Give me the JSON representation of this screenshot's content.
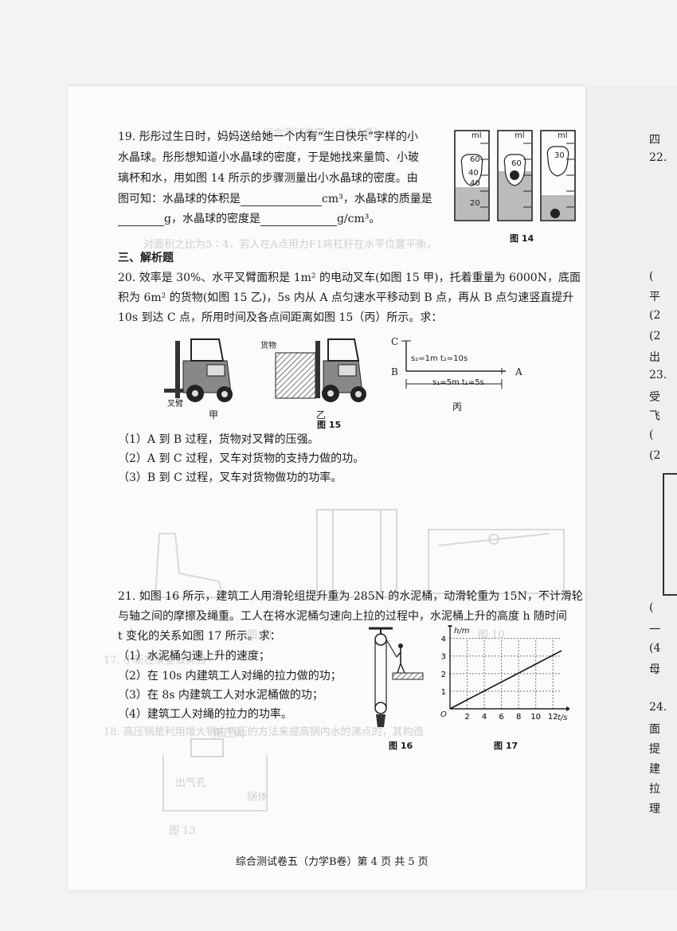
{
  "q19": {
    "line1": "19.  彤彤过生日时，妈妈送给她一个内有“生日快乐”字样的小",
    "line2": "水晶球。彤彤想知道小水晶球的密度，于是她找来量筒、小玻",
    "line3": "璃杯和水，用如图 14 所示的步骤测量出小水晶球的密度。由",
    "line4a": "图可知：水晶球的体积是",
    "line4b": "cm³，水晶球的质量是",
    "line5a": "g，水晶球的密度是",
    "line5b": "g/cm³。",
    "figure_caption": "图 14",
    "cylinder_unit": "ml",
    "cylinder_ticks": [
      "60",
      "40",
      "20"
    ],
    "cylinder_readings": [
      "40",
      "60",
      "30"
    ]
  },
  "section3": "三、解析题",
  "q20": {
    "line1": "20.  效率是 30%、水平叉臂面积是 1m² 的电动叉车(如图 15 甲)，托着重量为 6000N，底面",
    "line2": "积为 6m² 的货物(如图 15 乙)，5s 内从 A 点匀速水平移动到 B 点，再从 B 点匀速竖直提升",
    "line3": "10s 到达 C 点，所用时间及各点间距离如图 15（丙）所示。求：",
    "label_fork": "叉臂",
    "label_cargo": "货物",
    "sub_jia": "甲",
    "sub_yi": "乙",
    "sub_bing": "丙",
    "point_a": "A",
    "point_b": "B",
    "point_c": "C",
    "s2_text": "s₂=1m t₂=10s",
    "s1_text": "s₁=5m t₁=5s",
    "figure_caption": "图 15",
    "sub1": "（1）A 到 B 过程，货物对叉臂的压强。",
    "sub2": "（2）A 到 C 过程，叉车对货物的支持力做的功。",
    "sub3": "（3）B 到 C 过程，叉车对货物做功的功率。"
  },
  "q21": {
    "line1": "21.  如图 16 所示，建筑工人用滑轮组提升重为 285N 的水泥桶，动滑轮重为 15N，不计滑轮",
    "line2": "与轴之间的摩擦及绳重。工人在将水泥桶匀速向上拉的过程中，水泥桶上升的高度 h 随时间",
    "line3": "t 变化的关系如图 17 所示。求：",
    "sub1": "（1）水泥桶匀速上升的速度；",
    "sub2": "（2）在 10s 内建筑工人对绳的拉力做的功；",
    "sub3": "（3）在 8s 内建筑工人对水泥桶做的功；",
    "sub4": "（4）建筑工人对绳的拉力的功率。",
    "fig16_caption": "图 16",
    "fig17_caption": "图 17",
    "graph_ylabel": "h/m",
    "graph_xlabel": "t/s",
    "graph_origin": "O"
  },
  "chart_data": {
    "type": "line",
    "xlabel": "t/s",
    "ylabel": "h/m",
    "x_ticks": [
      "2",
      "4",
      "6",
      "8",
      "10",
      "12"
    ],
    "y_ticks": [
      "1",
      "2",
      "3",
      "4"
    ],
    "xlim": [
      0,
      13
    ],
    "ylim": [
      0,
      4.3
    ],
    "series": [
      {
        "x": [
          0,
          13
        ],
        "y": [
          0,
          3.3
        ]
      }
    ],
    "grid": true
  },
  "ghost_text": {
    "g1": "对面积之比为5∶4，若人在A点用力F1将杠杆在水平位置平衡，",
    "g2": "综合测试卷四（力学A卷）",
    "g3": "图 11",
    "g4": "图 10",
    "g5": "图 13",
    "g6": "限压阀",
    "g7": "出气孔",
    "g8": "锅体",
    "g9": "17. 小新在家里做实验",
    "g10": "18. 高压锅是利用增大锅内气压的方法来提高锅内水的沸点的，其构造"
  },
  "edge_text": [
    "四",
    "22.",
    "(",
    "平",
    "(2",
    "(2",
    "出",
    "23.",
    "受",
    "飞",
    "(",
    "(2",
    "(",
    "一",
    "(4",
    "母",
    "24.",
    "面",
    "提",
    "建",
    "拉",
    "理"
  ],
  "footer": "综合测试卷五（力学B卷）第 4 页 共 5 页"
}
